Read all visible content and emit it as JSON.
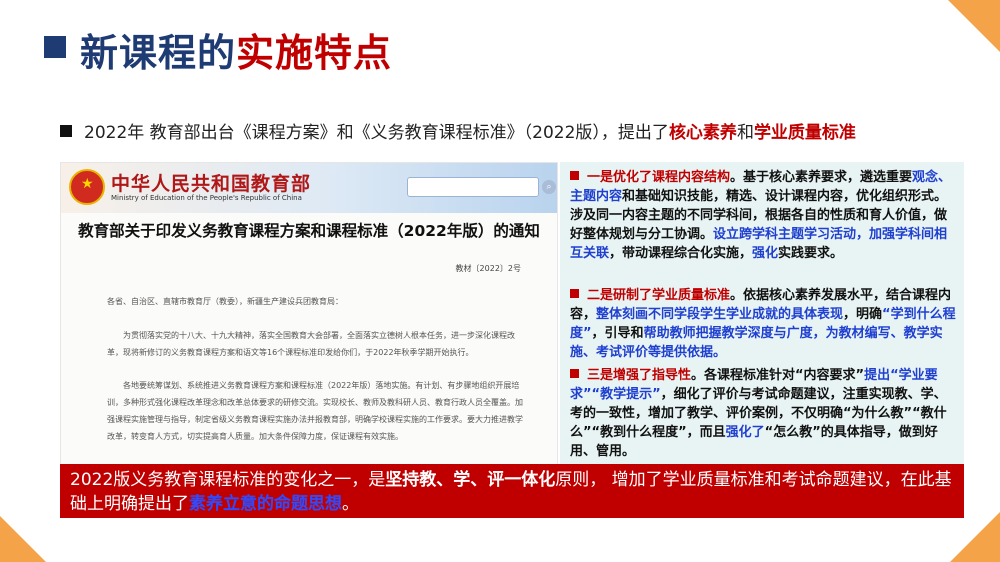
{
  "title": {
    "part1": "新课程的",
    "part2": "实施特点"
  },
  "subline": {
    "text": "2022年   教育部出台《课程方案》和《义务教育课程标准》（2022版），提出了",
    "hl1": "核心素养",
    "mid": "和",
    "hl2": "学业质量标准"
  },
  "doc": {
    "ministry": "中华人民共和国教育部",
    "ministry_en": "Ministry of Education of the People's Republic of China",
    "search_icon": "search-icon",
    "title": "教育部关于印发义务教育课程方案和课程标准（2022年版）的通知",
    "doc_no": "教材〔2022〕2号",
    "p1": "各省、自治区、直辖市教育厅（教委），新疆生产建设兵团教育局：",
    "p2": "为贯彻落实党的十八大、十九大精神，落实全国教育大会部署，全面落实立德树人根本任务，进一步深化课程改革，现将新修订的义务教育课程方案和语文等16个课程标准印发给你们，于2022年秋季学期开始执行。",
    "p3": "各地要统筹谋划、系统推进义务教育课程方案和课程标准（2022年版）落地实施。有计划、有步骤地组织开展培训，多种形式强化课程改革理念和改革总体要求的研修交流。实现校长、教师及教科研人员、教育行政人员全覆盖。加强课程实施管理与指导，制定省级义务教育课程实施办法并报教育部，明确学校课程实施的工作要求。要大力推进教学改革，转变育人方式，切实提高育人质量。加大条件保障力度，保证课程有效实施。"
  },
  "items": [
    {
      "a": "一是优化了课程内容结构",
      "b": "。基于核心素养要求，遴选重要",
      "c": "观念、主题内容",
      "d": "和基础知识技能，精选、设计课程内容，优化组织形式。涉及同一内容主题的不同学科间，根据各自的性质和育人价值，做好整体规划与分工协调。",
      "e": "设立跨学科主题学习活动，加强学科间相互关联",
      "f": "，带动课程综合化实施，",
      "g": "强化",
      "h": "实践要求。"
    },
    {
      "a": "二是研制了学业质量标准",
      "b": "。依据核心素养发展水平，结合课程内容，",
      "c": "整体刻画不同学段学生学业成就的具体表现",
      "d": "，明确",
      "e": "“学到什么程度”",
      "f": "，引导和",
      "g": "帮助教师把握教学深度与广度，为教材编写、教学实施、考试评价等提供依据。"
    },
    {
      "a": "三是增强了指导性",
      "b": "。各课程标准针对“内容要求”",
      "c": "提出“学业要求”“教学提示”",
      "d": "，细化了评价与考试命题建议，注重实现教、学、考的一致性，增加了教学、评价案例，不仅明确“为什么教”“教什么”“教到什么程度”，而且",
      "e": "强化了",
      "f": "“怎么教”的具体指导，做到好用、管用。"
    }
  ],
  "banner": {
    "t1": "2022版义务教育课程标准的变化之一，是",
    "t2": "坚持教、学、评一体化",
    "t3": "原则， 增加了学业质量标准和考试命题建议，在此基础上明确提出了",
    "t4": "素养立意的命题思想",
    "t5": "。"
  },
  "colors": {
    "navy": "#1f3b74",
    "red": "#c00000",
    "blue": "#1f3fd0",
    "orange": "#f5a348"
  }
}
